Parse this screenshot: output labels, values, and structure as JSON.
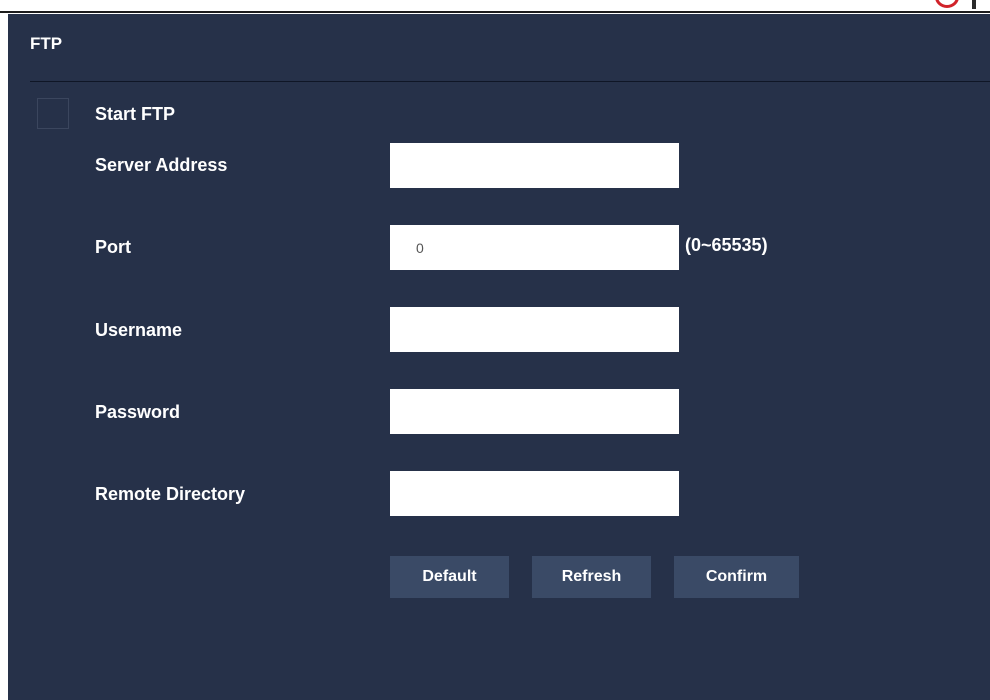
{
  "panel": {
    "title": "FTP"
  },
  "start_ftp": {
    "label": "Start FTP",
    "checked": false
  },
  "fields": {
    "server_address": {
      "label": "Server Address",
      "value": ""
    },
    "port": {
      "label": "Port",
      "value": "0",
      "range_hint": "(0~65535)"
    },
    "username": {
      "label": "Username",
      "value": ""
    },
    "password": {
      "label": "Password",
      "value": ""
    },
    "remote_directory": {
      "label": "Remote Directory",
      "value": ""
    }
  },
  "buttons": {
    "default_label": "Default",
    "refresh_label": "Refresh",
    "confirm_label": "Confirm"
  },
  "colors": {
    "panel_background": "#263149",
    "button_background": "#3a4a66",
    "brand_accent": "#d1232a"
  }
}
